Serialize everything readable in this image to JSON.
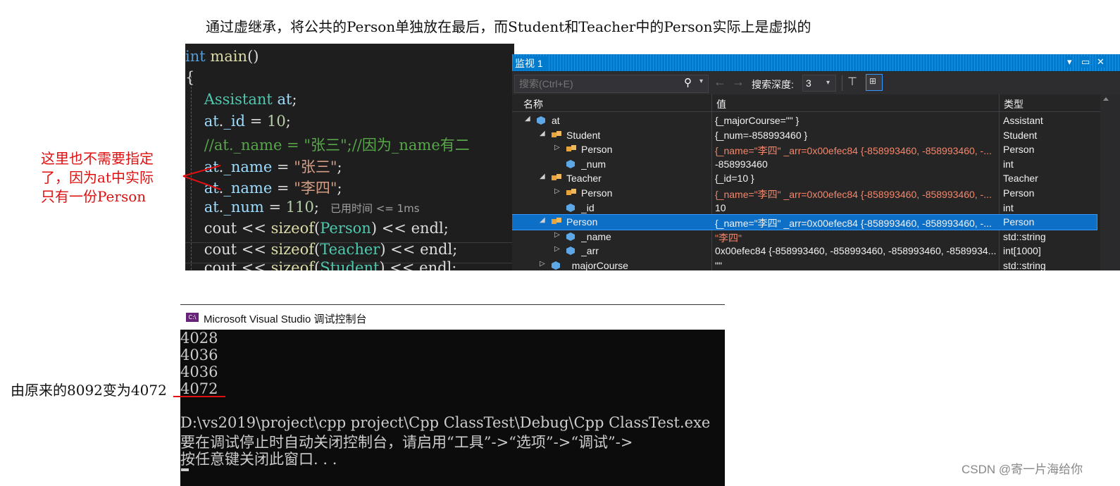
{
  "caption": "通过虚继承，将公共的Person单独放在最后，而Student和Teacher中的Person实际上是虚拟的",
  "editor": {
    "lines": [
      "int main()",
      "{",
      "    Assistant at;",
      "    at._id = 10;",
      "    //at._name = \"张三\";//因为_name有二",
      "    at._name = \"张三\";",
      "    at._name = \"李四\";",
      "    at._num = 110;",
      "    cout << sizeof(Person) << endl;",
      "    cout << sizeof(Teacher) << endl;",
      "    cout << sizeof(Student) << endl;"
    ],
    "elapsed": "已用时间 <= 1ms"
  },
  "annotation_left": [
    "这里也不需要指定",
    "了，因为at中实际",
    "只有一份Person"
  ],
  "watch": {
    "title": "监视 1",
    "search_placeholder": "搜索(Ctrl+E)",
    "depth_label": "搜索深度:",
    "depth_value": "3",
    "columns": [
      "名称",
      "值",
      "类型"
    ],
    "rows": [
      {
        "indent": 0,
        "expand": "open",
        "icon": "object",
        "name": "at",
        "value": "{_majorCourse=\"\" }",
        "type": "Assistant",
        "red": false,
        "sel": false
      },
      {
        "indent": 1,
        "expand": "open",
        "icon": "class",
        "name": "Student",
        "value": "{_num=-858993460 }",
        "type": "Student",
        "red": false,
        "sel": false
      },
      {
        "indent": 2,
        "expand": "closed",
        "icon": "class",
        "name": "Person",
        "value": "{_name=\"李四\" _arr=0x00efec84 {-858993460, -858993460, -...",
        "type": "Person",
        "red": true,
        "sel": false
      },
      {
        "indent": 2,
        "expand": "none",
        "icon": "field",
        "name": "_num",
        "value": "-858993460",
        "type": "int",
        "red": false,
        "sel": false
      },
      {
        "indent": 1,
        "expand": "open",
        "icon": "class",
        "name": "Teacher",
        "value": "{_id=10 }",
        "type": "Teacher",
        "red": false,
        "sel": false
      },
      {
        "indent": 2,
        "expand": "closed",
        "icon": "class",
        "name": "Person",
        "value": "{_name=\"李四\" _arr=0x00efec84 {-858993460, -858993460, -...",
        "type": "Person",
        "red": true,
        "sel": false
      },
      {
        "indent": 2,
        "expand": "none",
        "icon": "field",
        "name": "_id",
        "value": "10",
        "type": "int",
        "red": false,
        "sel": false
      },
      {
        "indent": 1,
        "expand": "open",
        "icon": "class",
        "name": "Person",
        "value": "{_name=\"李四\" _arr=0x00efec84 {-858993460, -858993460, -...",
        "type": "Person",
        "red": false,
        "sel": true
      },
      {
        "indent": 2,
        "expand": "closed",
        "icon": "field",
        "name": "_name",
        "value": "\"李四\"",
        "type": "std::string",
        "red": true,
        "sel": false
      },
      {
        "indent": 2,
        "expand": "closed",
        "icon": "field",
        "name": "_arr",
        "value": "0x00efec84 {-858993460, -858993460, -858993460, -8589934...",
        "type": "int[1000]",
        "red": false,
        "sel": false
      },
      {
        "indent": 1,
        "expand": "closed",
        "icon": "field",
        "name": "_majorCourse",
        "value": "\"\"",
        "type": "std::string",
        "red": false,
        "sel": false
      }
    ]
  },
  "console": {
    "title": "Microsoft Visual Studio 调试控制台",
    "lines": [
      "4028",
      "4036",
      "4036",
      "4072",
      "",
      "D:\\vs2019\\project\\cpp project\\Cpp ClassTest\\Debug\\Cpp ClassTest.exe",
      "要在调试停止时自动关闭控制台，请启用“工具”->“选项”->“调试”->",
      "按任意键关闭此窗口. . ."
    ]
  },
  "annotation_bottom": "由原来的8092变为4072",
  "watermark": "CSDN @寄一片海给你",
  "colors": {
    "accent": "#007acc",
    "selection": "#0e6fc7",
    "annotation": "#e01010",
    "string_value": "#f5866a"
  }
}
